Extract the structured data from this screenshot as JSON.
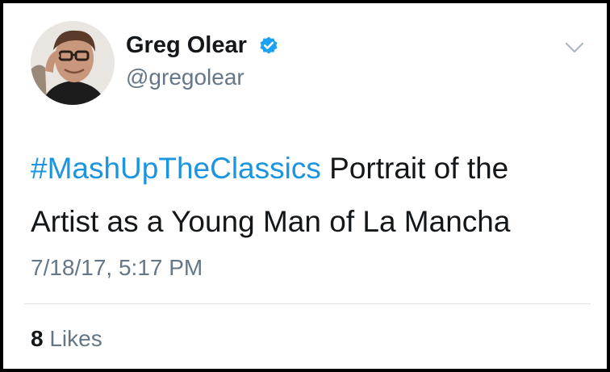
{
  "tweet": {
    "author": {
      "name": "Greg Olear",
      "handle": "@gregolear",
      "verified_icon": "verified-badge-icon",
      "avatar": "author-avatar"
    },
    "hashtag": "#MashUpTheClassics",
    "body_line1": " Portrait of the",
    "body_line2": "Artist as a Young Man of La Mancha",
    "timestamp": "7/18/17, 5:17 PM",
    "likes_count": "8",
    "likes_label": " Likes",
    "menu_icon": "chevron-down-icon"
  },
  "colors": {
    "link": "#1b95e0",
    "verified": "#1da1f2",
    "text_primary": "#14171a",
    "text_secondary": "#657786",
    "divider": "#dfe3e8"
  }
}
